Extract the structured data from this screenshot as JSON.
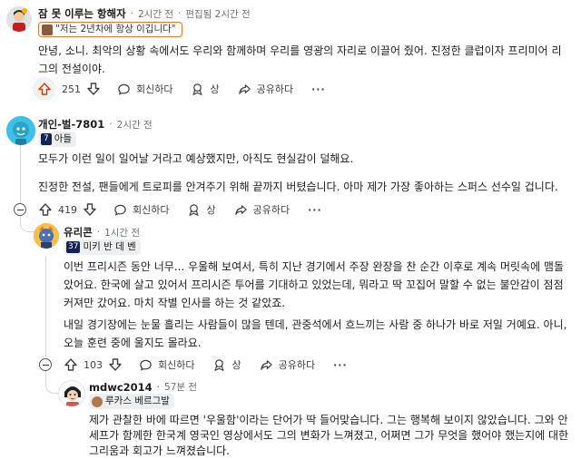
{
  "comments": [
    {
      "username": "잠 못 이루는 항해자",
      "time": "2시간 전",
      "edited": "편집됨 2시간 전",
      "flair": "\"저는 2년차에 항상 이깁니다\"",
      "body": "안녕, 소니. 최악의 상황 속에서도 우리와 함께하며 우리를 영광의 자리로 이끌어 줬어. 진정한 클럽이자 프리미어 리그의 전설이야.",
      "votes": "251",
      "reply_label": "회신하다",
      "award_label": "상",
      "share_label": "공유하다",
      "more": "···"
    },
    {
      "username": "개인-벌-7801",
      "time": "2시간 전",
      "flair": "아들",
      "flair_number": "7",
      "body1": "모두가 이런 일이 일어날 거라고 예상했지만, 아직도 현실감이 덜해요.",
      "body2": "진정한 전설, 팬들에게 트로피를 안겨주기 위해 끝까지 버텼습니다. 아마 제가 가장 좋아하는 스퍼스 선수일 겁니다.",
      "votes": "419",
      "reply_label": "회신하다",
      "award_label": "상",
      "share_label": "공유하다",
      "more": "···"
    },
    {
      "username": "유리콘",
      "time": "1시간 전",
      "flair": "미키 반 데 벤",
      "flair_number": "37",
      "body1": "이번 프리시즌 동안 너무... 우울해 보여서, 특히 지난 경기에서 주장 완장을 찬 순간 이후로 계속 머릿속에 맴돌았어요. 한국에 살고 있어서 프리시즌 투어를 기대하고 있었는데, 뭐라고 딱 꼬집어 말할 수 없는 불안감이 점점 커져만 갔어요. 마치 작별 인사를 하는 것 같았죠.",
      "body2": "내일 경기장에는 눈물 흘리는 사람들이 많을 텐데, 관중석에서 흐느끼는 사람 중 하나가 바로 저일 거예요. 아니, 오늘 훈련 중에 울지도 몰라요.",
      "votes": "103",
      "reply_label": "회신하다",
      "award_label": "상",
      "share_label": "공유하다",
      "more": "···"
    },
    {
      "username": "mdwc2014",
      "time": "57분 전",
      "flair": "루카스 베르그발",
      "body": "제가 관찰한 바에 따르면 '우울함'이라는 단어가 딱 들어맞습니다. 그는 행복해 보이지 않았습니다. 그와 안세프가 함께한 한국계 영국인 영상에서도 그의 변화가 느껴졌고, 어쩌면 그가 무엇을 했어야 했는지에 대한 그리움과 회고가 느껴졌습니다."
    }
  ],
  "colors": {
    "upvote_active": "#d93a00",
    "flair_border": "#e8752c",
    "thread_line": "#d4d7d9"
  }
}
